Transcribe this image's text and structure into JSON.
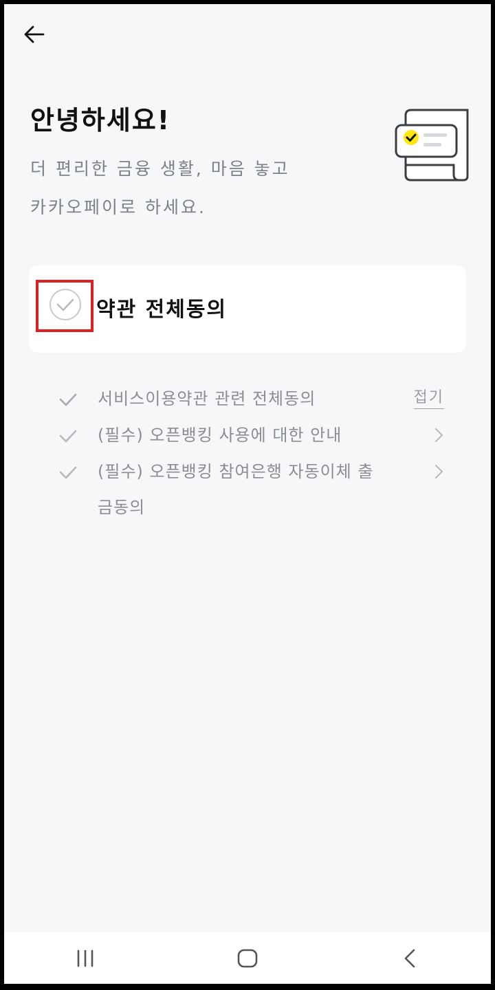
{
  "header": {
    "back_icon": "arrow-left-icon"
  },
  "intro": {
    "greeting": "안녕하세요!",
    "subtitle_line1": "더 편리한 금융 생활, 마음 놓고",
    "subtitle_line2": "카카오페이로 하세요.",
    "illustration": "document-check-icon",
    "accent_color": "#ffe812"
  },
  "agree_all": {
    "label": "약관 전체동의",
    "checked": false
  },
  "terms": [
    {
      "label": "서비스이용약관 관련 전체동의",
      "action": "접기"
    },
    {
      "label": "(필수) 오픈뱅킹 사용에 대한 안내",
      "action_icon": "chevron-right-icon"
    },
    {
      "label": "(필수) 오픈뱅킹 참여은행 자동이체 출금동의",
      "action_icon": "chevron-right-icon"
    }
  ],
  "nav": {
    "recents_icon": "recent-apps-icon",
    "home_icon": "home-icon",
    "back_icon": "back-icon"
  }
}
